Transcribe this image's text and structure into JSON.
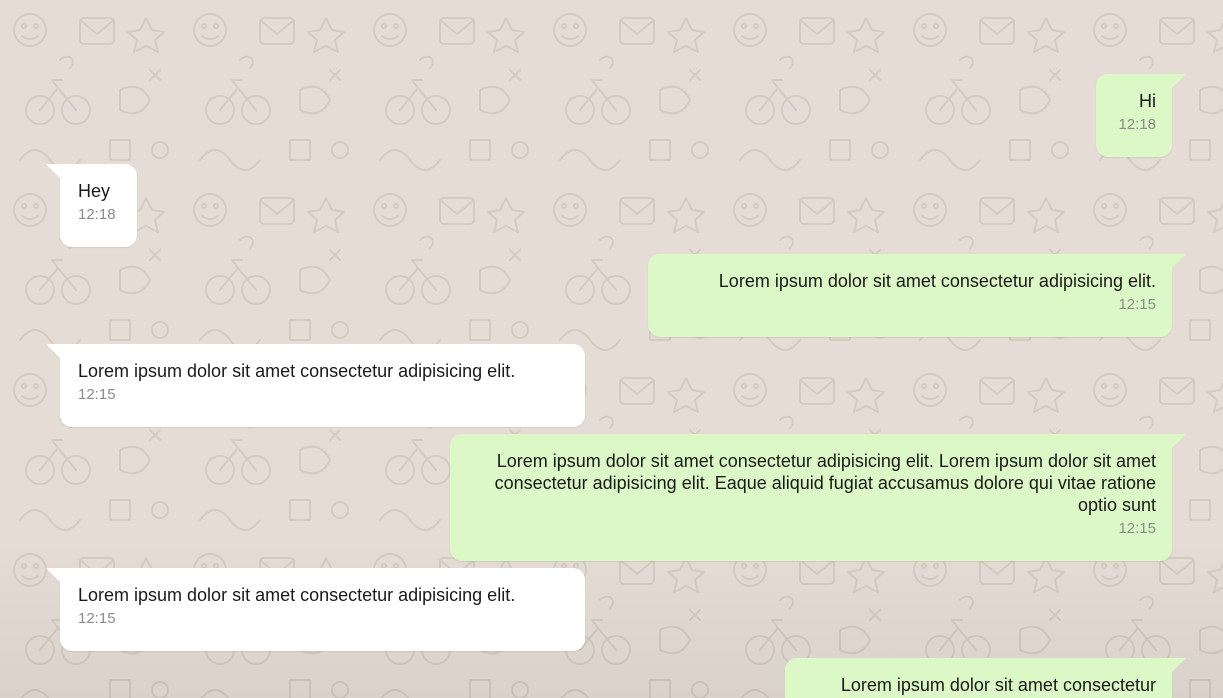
{
  "theme": {
    "background": "#e5ddd5",
    "incoming_bubble": "#ffffff",
    "outgoing_bubble": "#dcf8c6",
    "timestamp_color": "#8c8c8c"
  },
  "messages": [
    {
      "direction": "outgoing",
      "text": "Hi",
      "time": "12:18"
    },
    {
      "direction": "incoming",
      "text": "Hey",
      "time": "12:18"
    },
    {
      "direction": "outgoing",
      "text": "Lorem ipsum dolor sit amet consectetur adipisicing elit.",
      "time": "12:15"
    },
    {
      "direction": "incoming",
      "text": "Lorem ipsum dolor sit amet consectetur adipisicing elit.",
      "time": "12:15"
    },
    {
      "direction": "outgoing",
      "text": "Lorem ipsum dolor sit amet consectetur adipisicing elit. Lorem ipsum dolor sit amet consectetur adipisicing elit. Eaque aliquid fugiat accusamus dolore qui vitae ratione optio sunt",
      "time": "12:15"
    },
    {
      "direction": "incoming",
      "text": "Lorem ipsum dolor sit amet consectetur adipisicing elit.",
      "time": "12:15"
    },
    {
      "direction": "outgoing",
      "text": "Lorem ipsum dolor sit amet consectetur",
      "time": ""
    }
  ]
}
